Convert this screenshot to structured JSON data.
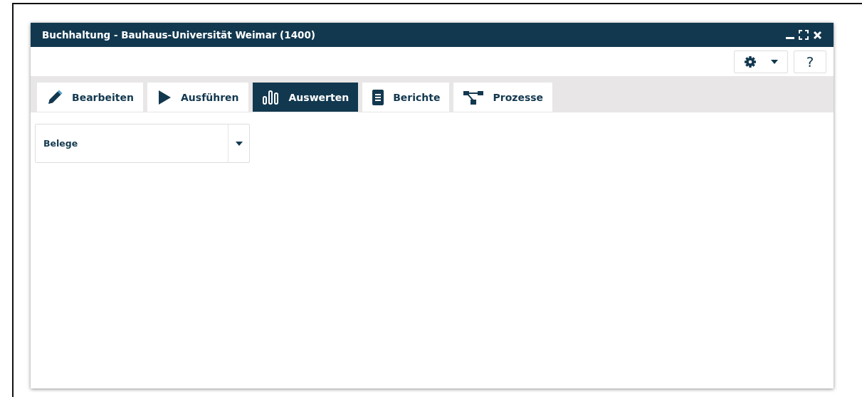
{
  "window": {
    "title": "Buchhaltung - Bauhaus-Universität Weimar (1400)"
  },
  "toolbar": {
    "help_label": "?"
  },
  "tabs": [
    {
      "label": "Bearbeiten",
      "selected": false
    },
    {
      "label": "Ausführen",
      "selected": false
    },
    {
      "label": "Auswerten",
      "selected": true
    },
    {
      "label": "Berichte",
      "selected": false
    },
    {
      "label": "Prozesse",
      "selected": false
    }
  ],
  "dropdown": {
    "value": "Belege"
  }
}
